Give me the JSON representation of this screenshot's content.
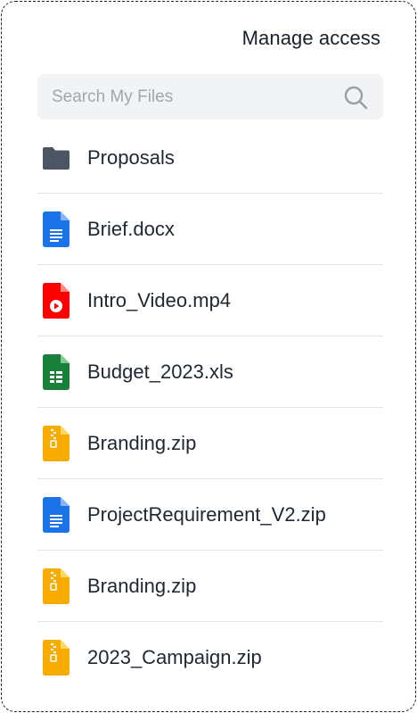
{
  "header": {
    "manage_access_label": "Manage access"
  },
  "search": {
    "placeholder": "Search My Files",
    "icon": "search-icon"
  },
  "files": [
    {
      "name": "Proposals",
      "icon": "folder-icon",
      "color": "#4b5563"
    },
    {
      "name": "Brief.docx",
      "icon": "doc-icon",
      "color": "#1a73e8"
    },
    {
      "name": "Intro_Video.mp4",
      "icon": "video-icon",
      "color": "#ff0000"
    },
    {
      "name": "Budget_2023.xls",
      "icon": "sheet-icon",
      "color": "#188038"
    },
    {
      "name": "Branding.zip",
      "icon": "zip-icon",
      "color": "#f9ab00"
    },
    {
      "name": "ProjectRequirement_V2.zip",
      "icon": "doc-icon",
      "color": "#1a73e8"
    },
    {
      "name": "Branding.zip",
      "icon": "zip-icon",
      "color": "#f9ab00"
    },
    {
      "name": "2023_Campaign.zip",
      "icon": "zip-icon",
      "color": "#f9ab00"
    }
  ]
}
